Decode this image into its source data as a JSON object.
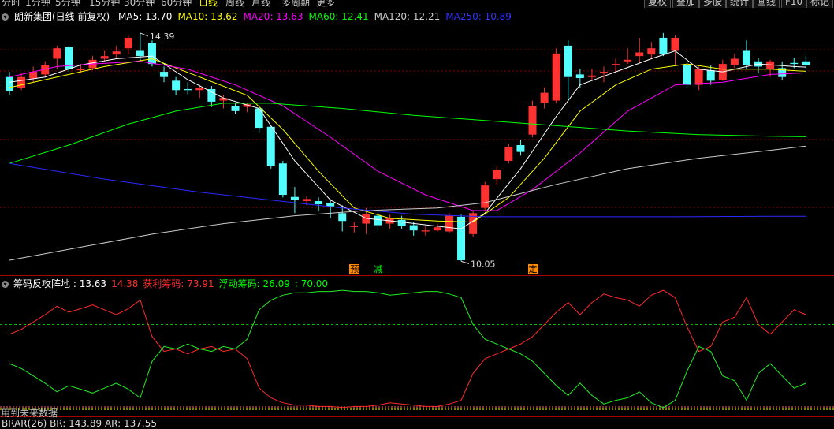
{
  "toolbar": {
    "periods": [
      "分时",
      "1分钟",
      "5分钟",
      "15分钟",
      "30分钟",
      "60分钟",
      "日线",
      "周线",
      "月线",
      "多周期",
      "更多"
    ],
    "active_period": "日线",
    "buttons": [
      "复权",
      "叠加",
      "多股",
      "统计",
      "画线",
      "F10",
      "标记"
    ]
  },
  "main_legend": {
    "title": "朗新集团(日线 前复权)",
    "items": [
      {
        "label": "MA5: 13.70",
        "color": "#ffffff"
      },
      {
        "label": "MA10: 13.62",
        "color": "#ffff00"
      },
      {
        "label": "MA20: 13.63",
        "color": "#ff00ff"
      },
      {
        "label": "MA60: 12.41",
        "color": "#00ff00"
      },
      {
        "label": "MA120: 12.21",
        "color": "#cccccc"
      },
      {
        "label": "MA250: 10.89",
        "color": "#3333ff"
      }
    ]
  },
  "annotations": {
    "high_label": "14.39",
    "low_label": "10.05"
  },
  "signals": [
    {
      "text": "预",
      "color": "#ff8c00",
      "index": 29
    },
    {
      "text": "减",
      "color": "#00ff00",
      "index": 31
    },
    {
      "text": "定",
      "color": "#ff8c00",
      "index": 44
    }
  ],
  "sub_legend": {
    "name": "筹码反攻阵地",
    "items": [
      {
        "label": ": 13.63",
        "color": "#ffffff"
      },
      {
        "label": "14.38",
        "color": "#ff3030"
      },
      {
        "label": "获利筹码: 73.91",
        "color": "#ff3030"
      },
      {
        "label": "浮动筹码: 26.09",
        "color": "#00ff00"
      },
      {
        "label": ": 70.00",
        "color": "#00ff00"
      }
    ]
  },
  "hint": "用到未来数据",
  "bottom_legend": "BRAR(26)  BR: 143.89  AR: 137.55",
  "colors": {
    "up": "#ff3232",
    "down": "#54ffff",
    "grid": "#8b0000"
  },
  "chart_data": {
    "type": "candlestick",
    "candles": [
      [
        13.55,
        13.28,
        13.65,
        13.2
      ],
      [
        13.35,
        13.55,
        13.62,
        13.3
      ],
      [
        13.52,
        13.65,
        13.75,
        13.45
      ],
      [
        13.6,
        13.78,
        13.85,
        13.55
      ],
      [
        13.9,
        14.1,
        14.15,
        13.7
      ],
      [
        14.12,
        13.7,
        14.15,
        13.65
      ],
      [
        13.68,
        13.7,
        13.8,
        13.62
      ],
      [
        13.72,
        13.88,
        13.95,
        13.68
      ],
      [
        13.9,
        13.95,
        14.05,
        13.85
      ],
      [
        13.98,
        14.04,
        14.15,
        13.92
      ],
      [
        14.1,
        14.3,
        14.34,
        13.98
      ],
      [
        14.05,
        13.95,
        14.39,
        13.85
      ],
      [
        14.2,
        13.8,
        14.25,
        13.75
      ],
      [
        13.65,
        13.55,
        13.75,
        13.45
      ],
      [
        13.48,
        13.3,
        13.55,
        13.2
      ],
      [
        13.32,
        13.3,
        13.45,
        13.22
      ],
      [
        13.3,
        13.35,
        13.4,
        13.15
      ],
      [
        13.32,
        13.08,
        13.38,
        12.98
      ],
      [
        13.1,
        13.15,
        13.2,
        12.95
      ],
      [
        13.0,
        12.9,
        13.05,
        12.85
      ],
      [
        12.98,
        13.03,
        13.05,
        12.88
      ],
      [
        12.95,
        12.58,
        12.98,
        12.48
      ],
      [
        12.6,
        11.85,
        12.62,
        11.8
      ],
      [
        11.9,
        11.3,
        11.95,
        11.25
      ],
      [
        11.26,
        11.2,
        11.45,
        10.95
      ],
      [
        11.18,
        11.22,
        11.28,
        11.1
      ],
      [
        11.18,
        11.12,
        11.25,
        10.98
      ],
      [
        11.15,
        11.08,
        11.22,
        10.85
      ],
      [
        10.95,
        10.8,
        11.1,
        10.6
      ],
      [
        10.7,
        10.7,
        10.78,
        10.58
      ],
      [
        10.75,
        10.93,
        11.05,
        10.55
      ],
      [
        10.9,
        10.72,
        10.98,
        10.62
      ],
      [
        10.75,
        10.85,
        10.92,
        10.65
      ],
      [
        10.82,
        10.7,
        10.9,
        10.65
      ],
      [
        10.72,
        10.62,
        10.78,
        10.52
      ],
      [
        10.6,
        10.62,
        10.7,
        10.52
      ],
      [
        10.62,
        10.68,
        10.75,
        10.6
      ],
      [
        10.6,
        10.9,
        10.95,
        10.58
      ],
      [
        10.88,
        10.05,
        10.92,
        10.03
      ],
      [
        10.55,
        10.95,
        11.0,
        10.5
      ],
      [
        11.05,
        11.48,
        11.55,
        10.98
      ],
      [
        11.6,
        11.78,
        11.85,
        11.5
      ],
      [
        11.95,
        12.22,
        12.28,
        11.9
      ],
      [
        12.25,
        12.12,
        12.35,
        12.05
      ],
      [
        12.45,
        13.0,
        13.1,
        12.4
      ],
      [
        13.05,
        13.25,
        13.35,
        12.95
      ],
      [
        13.1,
        14.0,
        14.1,
        13.05
      ],
      [
        14.15,
        13.55,
        14.25,
        13.1
      ],
      [
        13.6,
        13.53,
        13.7,
        13.35
      ],
      [
        13.55,
        13.58,
        13.7,
        13.5
      ],
      [
        13.62,
        13.65,
        13.75,
        13.45
      ],
      [
        13.78,
        13.8,
        13.9,
        13.65
      ],
      [
        13.85,
        13.88,
        14.1,
        13.8
      ],
      [
        13.95,
        14.02,
        14.3,
        13.82
      ],
      [
        13.98,
        14.1,
        14.22,
        13.9
      ],
      [
        14.3,
        13.98,
        14.39,
        13.95
      ],
      [
        14.05,
        14.3,
        14.35,
        13.78
      ],
      [
        13.78,
        13.4,
        13.82,
        13.35
      ],
      [
        13.4,
        13.7,
        13.75,
        13.3
      ],
      [
        13.68,
        13.48,
        13.78,
        13.4
      ],
      [
        13.5,
        13.8,
        13.88,
        13.48
      ],
      [
        13.78,
        13.9,
        14.0,
        13.72
      ],
      [
        14.05,
        13.78,
        14.25,
        13.7
      ],
      [
        13.85,
        13.75,
        13.92,
        13.62
      ],
      [
        13.7,
        13.85,
        13.88,
        13.55
      ],
      [
        13.72,
        13.55,
        13.85,
        13.5
      ],
      [
        13.82,
        13.8,
        13.92,
        13.72
      ],
      [
        13.85,
        13.78,
        13.95,
        13.7
      ]
    ],
    "ma": {
      "MA5": {
        "color": "#ffffff",
        "points": [
          [
            0,
            13.45
          ],
          [
            3,
            13.55
          ],
          [
            6,
            13.78
          ],
          [
            9,
            13.9
          ],
          [
            12,
            13.95
          ],
          [
            15,
            13.5
          ],
          [
            18,
            13.15
          ],
          [
            21,
            12.95
          ],
          [
            24,
            11.95
          ],
          [
            27,
            11.2
          ],
          [
            30,
            10.85
          ],
          [
            33,
            10.78
          ],
          [
            36,
            10.7
          ],
          [
            38,
            10.65
          ],
          [
            40,
            10.95
          ],
          [
            43,
            11.8
          ],
          [
            46,
            12.8
          ],
          [
            48,
            13.4
          ],
          [
            51,
            13.65
          ],
          [
            54,
            13.9
          ],
          [
            56,
            14.05
          ],
          [
            58,
            13.7
          ],
          [
            60,
            13.65
          ],
          [
            63,
            13.8
          ],
          [
            66,
            13.75
          ],
          [
            67,
            13.74
          ]
        ]
      },
      "MA10": {
        "color": "#ffff00",
        "points": [
          [
            0,
            13.35
          ],
          [
            4,
            13.55
          ],
          [
            8,
            13.75
          ],
          [
            12,
            13.9
          ],
          [
            16,
            13.55
          ],
          [
            20,
            13.2
          ],
          [
            23,
            12.55
          ],
          [
            26,
            11.75
          ],
          [
            29,
            11.05
          ],
          [
            32,
            10.85
          ],
          [
            36,
            10.8
          ],
          [
            39,
            10.78
          ],
          [
            42,
            11.25
          ],
          [
            45,
            12.0
          ],
          [
            48,
            12.9
          ],
          [
            51,
            13.4
          ],
          [
            54,
            13.7
          ],
          [
            57,
            13.8
          ],
          [
            60,
            13.7
          ],
          [
            64,
            13.7
          ],
          [
            67,
            13.66
          ]
        ]
      },
      "MA20": {
        "color": "#ff00ff",
        "points": [
          [
            0,
            13.55
          ],
          [
            4,
            13.75
          ],
          [
            7,
            13.8
          ],
          [
            11,
            13.85
          ],
          [
            15,
            13.7
          ],
          [
            19,
            13.4
          ],
          [
            23,
            13.0
          ],
          [
            27,
            12.4
          ],
          [
            31,
            11.75
          ],
          [
            35,
            11.3
          ],
          [
            39,
            11.0
          ],
          [
            41,
            11.0
          ],
          [
            44,
            11.4
          ],
          [
            48,
            12.1
          ],
          [
            52,
            12.9
          ],
          [
            56,
            13.4
          ],
          [
            60,
            13.45
          ],
          [
            64,
            13.6
          ],
          [
            67,
            13.63
          ]
        ]
      },
      "MA60": {
        "color": "#00ff00",
        "points": [
          [
            0,
            11.9
          ],
          [
            5,
            12.25
          ],
          [
            10,
            12.65
          ],
          [
            14,
            12.9
          ],
          [
            18,
            13.05
          ],
          [
            22,
            13.05
          ],
          [
            28,
            12.95
          ],
          [
            34,
            12.82
          ],
          [
            40,
            12.72
          ],
          [
            46,
            12.62
          ],
          [
            52,
            12.52
          ],
          [
            58,
            12.45
          ],
          [
            64,
            12.42
          ],
          [
            67,
            12.41
          ]
        ]
      },
      "MA120": {
        "color": "#cccccc",
        "points": [
          [
            0,
            10.05
          ],
          [
            6,
            10.3
          ],
          [
            12,
            10.55
          ],
          [
            18,
            10.75
          ],
          [
            24,
            10.9
          ],
          [
            30,
            11.0
          ],
          [
            36,
            11.05
          ],
          [
            40,
            11.15
          ],
          [
            46,
            11.5
          ],
          [
            52,
            11.8
          ],
          [
            58,
            12.0
          ],
          [
            64,
            12.15
          ],
          [
            67,
            12.23
          ]
        ]
      },
      "MA250": {
        "color": "#2a2aff",
        "points": [
          [
            0,
            11.9
          ],
          [
            8,
            11.6
          ],
          [
            16,
            11.35
          ],
          [
            22,
            11.2
          ],
          [
            28,
            11.05
          ],
          [
            34,
            10.93
          ],
          [
            40,
            10.88
          ],
          [
            48,
            10.88
          ],
          [
            56,
            10.88
          ],
          [
            64,
            10.89
          ],
          [
            67,
            10.89
          ]
        ]
      }
    },
    "y_range": [
      9.9,
      14.6
    ],
    "profit_chips": [
      62,
      66,
      72,
      78,
      85,
      80,
      83,
      86,
      82,
      78,
      83,
      90,
      60,
      48,
      50,
      46,
      50,
      52,
      48,
      50,
      42,
      18,
      10,
      6,
      4,
      4,
      3,
      3,
      2,
      3,
      3,
      4,
      6,
      5,
      4,
      3,
      3,
      5,
      8,
      30,
      42,
      46,
      50,
      54,
      60,
      70,
      80,
      88,
      78,
      88,
      95,
      92,
      90,
      85,
      94,
      98,
      92,
      68,
      48,
      52,
      72,
      76,
      92,
      70,
      62,
      72,
      82,
      78
    ],
    "floating_chips": [
      38,
      34,
      28,
      22,
      15,
      20,
      17,
      14,
      18,
      22,
      17,
      10,
      40,
      52,
      50,
      54,
      50,
      48,
      52,
      50,
      58,
      82,
      90,
      94,
      96,
      96,
      97,
      97,
      98,
      97,
      97,
      96,
      94,
      95,
      96,
      97,
      97,
      95,
      92,
      70,
      58,
      54,
      50,
      46,
      40,
      30,
      20,
      12,
      22,
      12,
      5,
      8,
      10,
      15,
      6,
      2,
      8,
      32,
      52,
      48,
      28,
      24,
      8,
      30,
      38,
      28,
      18,
      22
    ],
    "sub_level": 70.0,
    "sub_range": [
      0,
      100
    ]
  }
}
